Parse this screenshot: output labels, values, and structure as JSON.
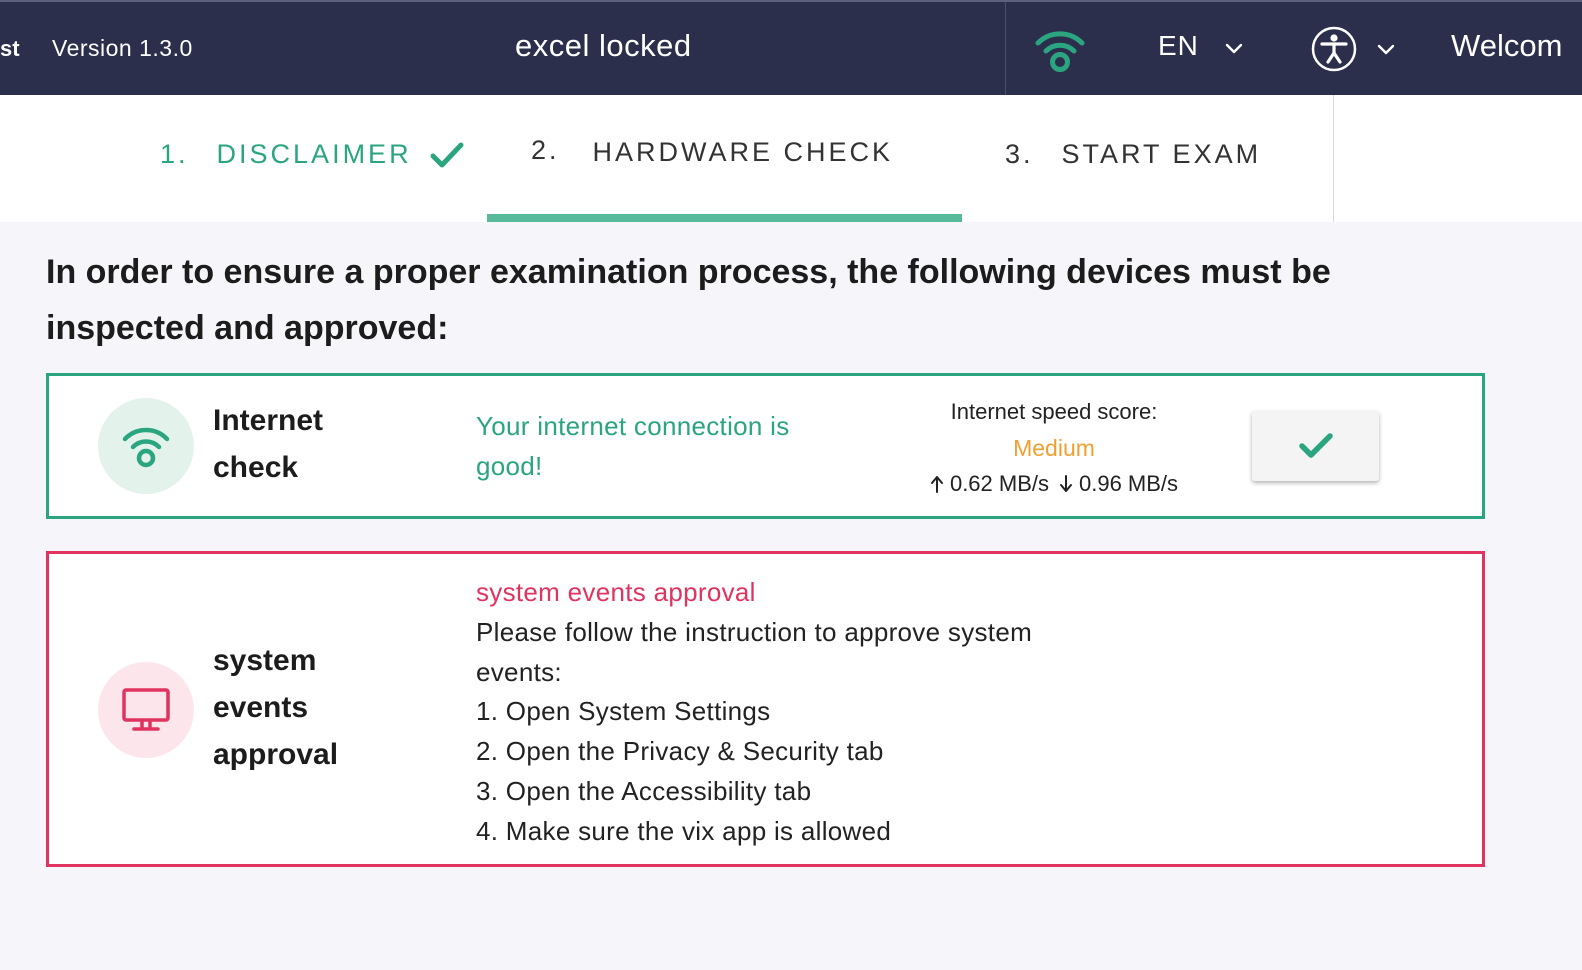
{
  "header": {
    "cut_title": "st",
    "version": "Version 1.3.0",
    "exam_title": "excel locked",
    "language": "EN",
    "welcome": "Welcom",
    "icons": {
      "connection": "wifi-icon",
      "accessibility": "accessibility-icon",
      "dropdown": "chevron-down-icon"
    }
  },
  "stepper": {
    "steps": [
      {
        "number": "1.",
        "label": "DISCLAIMER",
        "state": "completed"
      },
      {
        "number": "2.",
        "label": "HARDWARE CHECK",
        "state": "active"
      },
      {
        "number": "3.",
        "label": "START EXAM",
        "state": "pending"
      }
    ]
  },
  "main": {
    "heading": "In order to ensure a proper examination process, the following devices must be inspected and approved:",
    "internet_check": {
      "title": "Internet check",
      "status": "Your internet connection is good!",
      "speed_label": "Internet speed score:",
      "speed_score": "Medium",
      "upload": "0.62 MB/s",
      "download": "0.96 MB/s",
      "icon": "wifi-icon",
      "action_icon": "check-icon"
    },
    "system_events": {
      "title": "system events approval",
      "heading": "system events approval",
      "instruction": "Please follow the instruction to approve system events:",
      "steps": [
        "1. Open System Settings",
        "2. Open the Privacy & Security tab",
        "3. Open the Accessibility tab",
        "4. Make sure the vix app is allowed"
      ],
      "icon": "monitor-icon"
    }
  },
  "colors": {
    "header_bg": "#2b2f4c",
    "accent_green": "#2aa57f",
    "error_red": "#e0335f",
    "warning_orange": "#f0a030",
    "page_bg": "#f6f6fa"
  }
}
